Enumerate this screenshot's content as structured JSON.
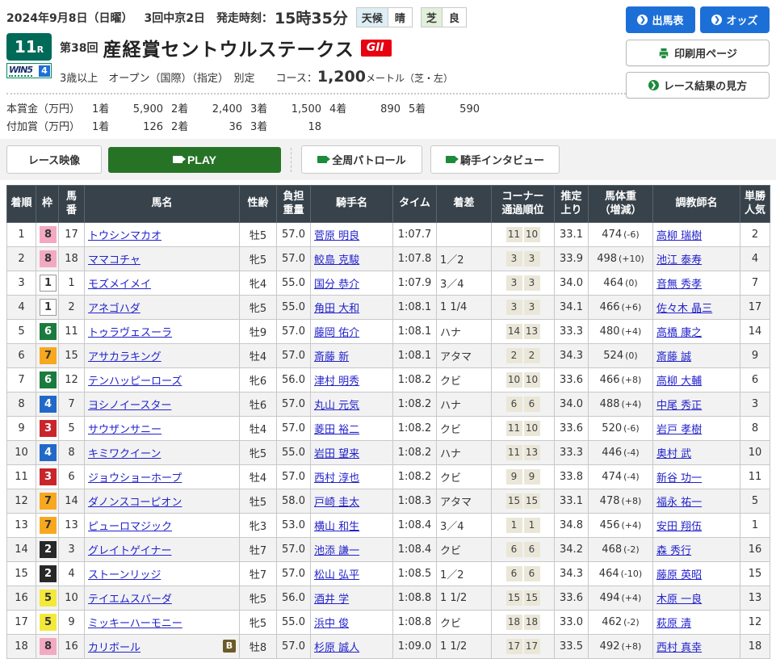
{
  "colors": {
    "accent_blue": "#1d6fd8",
    "accent_green": "#267326",
    "icon_green": "#1d8a3c",
    "grade_red": "#e60012",
    "table_header_bg": "#37424b",
    "race_badge_green": "#006a58"
  },
  "header": {
    "date": "2024年9月8日（日曜）",
    "meeting": "3回中京2日",
    "start_label": "発走時刻：",
    "start_time": "15時35分",
    "weather_label": "天候",
    "weather_value": "晴",
    "turf_label": "芝",
    "turf_value": "良",
    "race_number": "11",
    "race_number_suffix": "R",
    "win5_text": "WIN5",
    "win5_number": "4",
    "race_edition": "第38回",
    "race_name": "産経賞セントウルステークス",
    "grade": "GII",
    "conditions": "3歳以上　オープン（国際）（指定）　別定",
    "course_label": "コース：",
    "course_value": "1,200",
    "course_unit": "メートル（芝・左）"
  },
  "actions": {
    "entries": "出馬表",
    "odds": "オッズ",
    "print": "印刷用ページ",
    "how_to_read": "レース結果の見方"
  },
  "prizes": [
    {
      "label": "本賞金（万円）",
      "items": [
        {
          "place": "1着",
          "amount": "5,900"
        },
        {
          "place": "2着",
          "amount": "2,400"
        },
        {
          "place": "3着",
          "amount": "1,500"
        },
        {
          "place": "4着",
          "amount": "890"
        },
        {
          "place": "5着",
          "amount": "590"
        }
      ]
    },
    {
      "label": "付加賞（万円）",
      "items": [
        {
          "place": "1着",
          "amount": "126"
        },
        {
          "place": "2着",
          "amount": "36"
        },
        {
          "place": "3着",
          "amount": "18"
        }
      ]
    }
  ],
  "video_buttons": {
    "race_video": "レース映像",
    "play": "PLAY",
    "patrol": "全周パトロール",
    "interview": "騎手インタビュー"
  },
  "table": {
    "headers": [
      "着順",
      "枠",
      "馬\n番",
      "馬名",
      "性齢",
      "負担\n重量",
      "騎手名",
      "タイム",
      "着差",
      "コーナー\n通過順位",
      "推定\n上り",
      "馬体重\n（増減）",
      "調教師名",
      "単勝\n人気"
    ],
    "rows": [
      {
        "rank": "1",
        "frame": "8",
        "num": "17",
        "name": "トウシンマカオ",
        "blinker": false,
        "sex_age": "牡5",
        "weight": "57.0",
        "jockey": "菅原 明良",
        "time": "1:07.7",
        "margin": "",
        "corner": [
          "11",
          "10"
        ],
        "last3f": "33.1",
        "horse_weight": "474",
        "weight_diff": "(-6)",
        "trainer": "高柳 瑞樹",
        "popularity": "2"
      },
      {
        "rank": "2",
        "frame": "8",
        "num": "18",
        "name": "ママコチャ",
        "blinker": false,
        "sex_age": "牝5",
        "weight": "57.0",
        "jockey": "鮫島 克駿",
        "time": "1:07.8",
        "margin": "1／2",
        "corner": [
          "3",
          "3"
        ],
        "last3f": "33.9",
        "horse_weight": "498",
        "weight_diff": "(+10)",
        "trainer": "池江 泰寿",
        "popularity": "4"
      },
      {
        "rank": "3",
        "frame": "1",
        "num": "1",
        "name": "モズメイメイ",
        "blinker": false,
        "sex_age": "牝4",
        "weight": "55.0",
        "jockey": "国分 恭介",
        "time": "1:07.9",
        "margin": "3／4",
        "corner": [
          "3",
          "3"
        ],
        "last3f": "34.0",
        "horse_weight": "464",
        "weight_diff": "(0)",
        "trainer": "音無 秀孝",
        "popularity": "7"
      },
      {
        "rank": "4",
        "frame": "1",
        "num": "2",
        "name": "アネゴハダ",
        "blinker": false,
        "sex_age": "牝5",
        "weight": "55.0",
        "jockey": "角田 大和",
        "time": "1:08.1",
        "margin": "1 1/4",
        "corner": [
          "3",
          "3"
        ],
        "last3f": "34.1",
        "horse_weight": "466",
        "weight_diff": "(+6)",
        "trainer": "佐々木 晶三",
        "popularity": "17"
      },
      {
        "rank": "5",
        "frame": "6",
        "num": "11",
        "name": "トゥラヴェスーラ",
        "blinker": false,
        "sex_age": "牡9",
        "weight": "57.0",
        "jockey": "藤岡 佑介",
        "time": "1:08.1",
        "margin": "ハナ",
        "corner": [
          "14",
          "13"
        ],
        "last3f": "33.3",
        "horse_weight": "480",
        "weight_diff": "(+4)",
        "trainer": "高橋 康之",
        "popularity": "14"
      },
      {
        "rank": "6",
        "frame": "7",
        "num": "15",
        "name": "アサカラキング",
        "blinker": false,
        "sex_age": "牡4",
        "weight": "57.0",
        "jockey": "斎藤 新",
        "time": "1:08.1",
        "margin": "アタマ",
        "corner": [
          "2",
          "2"
        ],
        "last3f": "34.3",
        "horse_weight": "524",
        "weight_diff": "(0)",
        "trainer": "斎藤 誠",
        "popularity": "9"
      },
      {
        "rank": "7",
        "frame": "6",
        "num": "12",
        "name": "テンハッピーローズ",
        "blinker": false,
        "sex_age": "牝6",
        "weight": "56.0",
        "jockey": "津村 明秀",
        "time": "1:08.2",
        "margin": "クビ",
        "corner": [
          "10",
          "10"
        ],
        "last3f": "33.6",
        "horse_weight": "466",
        "weight_diff": "(+8)",
        "trainer": "高柳 大輔",
        "popularity": "6"
      },
      {
        "rank": "8",
        "frame": "4",
        "num": "7",
        "name": "ヨシノイースター",
        "blinker": false,
        "sex_age": "牡6",
        "weight": "57.0",
        "jockey": "丸山 元気",
        "time": "1:08.2",
        "margin": "ハナ",
        "corner": [
          "6",
          "6"
        ],
        "last3f": "34.0",
        "horse_weight": "488",
        "weight_diff": "(+4)",
        "trainer": "中尾 秀正",
        "popularity": "3"
      },
      {
        "rank": "9",
        "frame": "3",
        "num": "5",
        "name": "サウザンサニー",
        "blinker": false,
        "sex_age": "牡4",
        "weight": "57.0",
        "jockey": "菱田 裕二",
        "time": "1:08.2",
        "margin": "クビ",
        "corner": [
          "11",
          "10"
        ],
        "last3f": "33.6",
        "horse_weight": "520",
        "weight_diff": "(-6)",
        "trainer": "岩戸 孝樹",
        "popularity": "8"
      },
      {
        "rank": "10",
        "frame": "4",
        "num": "8",
        "name": "キミワクイーン",
        "blinker": false,
        "sex_age": "牝5",
        "weight": "55.0",
        "jockey": "岩田 望来",
        "time": "1:08.2",
        "margin": "ハナ",
        "corner": [
          "11",
          "13"
        ],
        "last3f": "33.3",
        "horse_weight": "446",
        "weight_diff": "(-4)",
        "trainer": "奥村 武",
        "popularity": "10"
      },
      {
        "rank": "11",
        "frame": "3",
        "num": "6",
        "name": "ジョウショーホープ",
        "blinker": false,
        "sex_age": "牡4",
        "weight": "57.0",
        "jockey": "西村 淳也",
        "time": "1:08.2",
        "margin": "クビ",
        "corner": [
          "9",
          "9"
        ],
        "last3f": "33.8",
        "horse_weight": "474",
        "weight_diff": "(-4)",
        "trainer": "新谷 功一",
        "popularity": "11"
      },
      {
        "rank": "12",
        "frame": "7",
        "num": "14",
        "name": "ダノンスコーピオン",
        "blinker": false,
        "sex_age": "牡5",
        "weight": "58.0",
        "jockey": "戸崎 圭太",
        "time": "1:08.3",
        "margin": "アタマ",
        "corner": [
          "15",
          "15"
        ],
        "last3f": "33.1",
        "horse_weight": "478",
        "weight_diff": "(+8)",
        "trainer": "福永 祐一",
        "popularity": "5"
      },
      {
        "rank": "13",
        "frame": "7",
        "num": "13",
        "name": "ピューロマジック",
        "blinker": false,
        "sex_age": "牝3",
        "weight": "53.0",
        "jockey": "横山 和生",
        "time": "1:08.4",
        "margin": "3／4",
        "corner": [
          "1",
          "1"
        ],
        "last3f": "34.8",
        "horse_weight": "456",
        "weight_diff": "(+4)",
        "trainer": "安田 翔伍",
        "popularity": "1"
      },
      {
        "rank": "14",
        "frame": "2",
        "num": "3",
        "name": "グレイトゲイナー",
        "blinker": false,
        "sex_age": "牡7",
        "weight": "57.0",
        "jockey": "池添 謙一",
        "time": "1:08.4",
        "margin": "クビ",
        "corner": [
          "6",
          "6"
        ],
        "last3f": "34.2",
        "horse_weight": "468",
        "weight_diff": "(-2)",
        "trainer": "森 秀行",
        "popularity": "16"
      },
      {
        "rank": "15",
        "frame": "2",
        "num": "4",
        "name": "ストーンリッジ",
        "blinker": false,
        "sex_age": "牡7",
        "weight": "57.0",
        "jockey": "松山 弘平",
        "time": "1:08.5",
        "margin": "1／2",
        "corner": [
          "6",
          "6"
        ],
        "last3f": "34.3",
        "horse_weight": "464",
        "weight_diff": "(-10)",
        "trainer": "藤原 英昭",
        "popularity": "15"
      },
      {
        "rank": "16",
        "frame": "5",
        "num": "10",
        "name": "テイエムスパーダ",
        "blinker": false,
        "sex_age": "牝5",
        "weight": "56.0",
        "jockey": "酒井 学",
        "time": "1:08.8",
        "margin": "1 1/2",
        "corner": [
          "15",
          "15"
        ],
        "last3f": "33.6",
        "horse_weight": "494",
        "weight_diff": "(+4)",
        "trainer": "木原 一良",
        "popularity": "13"
      },
      {
        "rank": "17",
        "frame": "5",
        "num": "9",
        "name": "ミッキーハーモニー",
        "blinker": false,
        "sex_age": "牝5",
        "weight": "55.0",
        "jockey": "浜中 俊",
        "time": "1:08.8",
        "margin": "クビ",
        "corner": [
          "18",
          "18"
        ],
        "last3f": "33.0",
        "horse_weight": "462",
        "weight_diff": "(-2)",
        "trainer": "萩原 清",
        "popularity": "12"
      },
      {
        "rank": "18",
        "frame": "8",
        "num": "16",
        "name": "カリボール",
        "blinker": true,
        "blinker_label": "B",
        "sex_age": "牡8",
        "weight": "57.0",
        "jockey": "杉原 誠人",
        "time": "1:09.0",
        "margin": "1 1/2",
        "corner": [
          "17",
          "17"
        ],
        "last3f": "33.5",
        "horse_weight": "492",
        "weight_diff": "(+8)",
        "trainer": "西村 真幸",
        "popularity": "18"
      }
    ]
  }
}
